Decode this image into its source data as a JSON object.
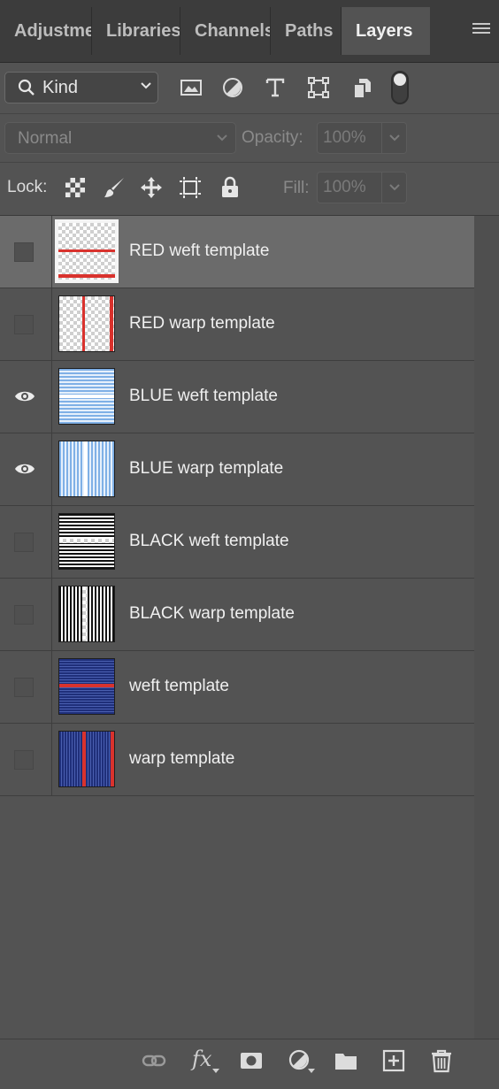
{
  "tabs": [
    {
      "label": "Adjustments",
      "active": false
    },
    {
      "label": "Libraries",
      "active": false
    },
    {
      "label": "Channels",
      "active": false
    },
    {
      "label": "Paths",
      "active": false
    },
    {
      "label": "Layers",
      "active": true
    }
  ],
  "filter": {
    "kind_label": "Kind",
    "icons": [
      "image-filter-icon",
      "adjustment-filter-icon",
      "type-filter-icon",
      "shape-filter-icon",
      "smart-object-filter-icon"
    ]
  },
  "blend": {
    "mode": "Normal",
    "opacity_label": "Opacity:",
    "opacity_value": "100%"
  },
  "lock": {
    "label": "Lock:",
    "fill_label": "Fill:",
    "fill_value": "100%",
    "icons": [
      "lock-transparent-pixels-icon",
      "lock-image-pixels-icon",
      "lock-position-icon",
      "lock-artboard-icon",
      "lock-all-icon"
    ]
  },
  "layers": [
    {
      "name": "RED weft template",
      "visible": false,
      "selected": true
    },
    {
      "name": "RED warp template",
      "visible": false,
      "selected": false
    },
    {
      "name": "BLUE weft template",
      "visible": true,
      "selected": false
    },
    {
      "name": "BLUE warp template",
      "visible": true,
      "selected": false
    },
    {
      "name": "BLACK weft template",
      "visible": false,
      "selected": false
    },
    {
      "name": "BLACK warp template",
      "visible": false,
      "selected": false
    },
    {
      "name": "weft template",
      "visible": false,
      "selected": false
    },
    {
      "name": "warp template",
      "visible": false,
      "selected": false
    }
  ],
  "bottom_bar": {
    "fx_label": "fx",
    "icons": [
      "link-layers-icon",
      "fx-icon",
      "layer-mask-icon",
      "adjustment-layer-icon",
      "group-folder-icon",
      "new-layer-icon",
      "trash-icon"
    ]
  },
  "colors": {
    "accent_red": "#d9322d",
    "thread_blue": "#2c3f8f",
    "light_blue": "#7fb0e6"
  }
}
